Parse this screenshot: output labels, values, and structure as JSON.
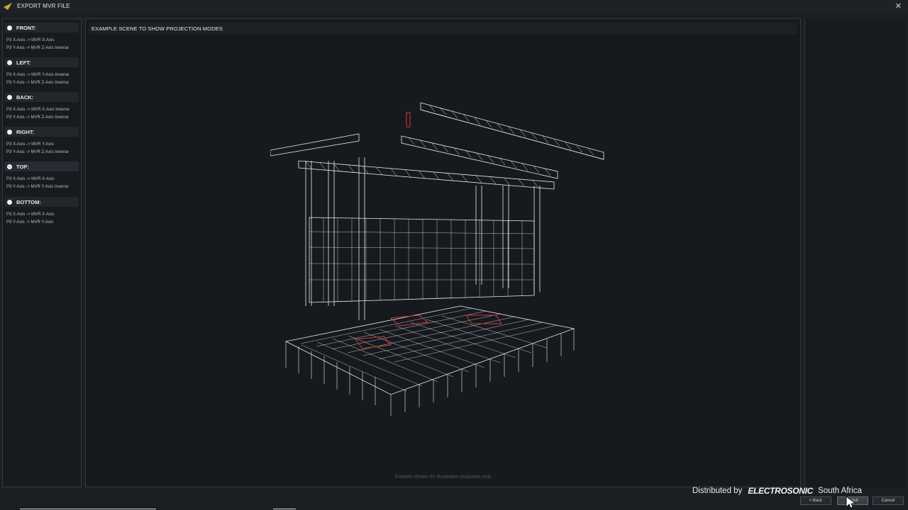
{
  "window": {
    "title": "EXPORT MVR FILE"
  },
  "modes": [
    {
      "label": "FRONT:",
      "lines": [
        "P3 X-Axis -> MVR X-Axis",
        "P3 Y-Axis -> MVR Z-Axis Inverse"
      ],
      "selected": false
    },
    {
      "label": "LEFT:",
      "lines": [
        "P3 X-Axis -> MVR Y-Axis Inverse",
        "P3 Y-Axis -> MVR Z-Axis Inverse"
      ],
      "selected": false
    },
    {
      "label": "BACK:",
      "lines": [
        "P3 X-Axis -> MVR X-Axis Inverse",
        "P3 Y-Axis -> MVR Z-Axis Inverse"
      ],
      "selected": false
    },
    {
      "label": "RIGHT:",
      "lines": [
        "P3 X-Axis -> MVR Y-Axis",
        "P3 Y-Axis -> MVR Z-Axis Inverse"
      ],
      "selected": false
    },
    {
      "label": "TOP:",
      "lines": [
        "P3 X-Axis -> MVR X-Axis",
        "P3 Y-Axis -> MVR Y-Axis Inverse"
      ],
      "selected": true
    },
    {
      "label": "BOTTOM:",
      "lines": [
        "P3 X-Axis -> MVR X-Axis",
        "P3 Y-Axis -> MVR Y-Axis"
      ],
      "selected": false
    }
  ],
  "scene": {
    "title": "EXAMPLE SCENE TO SHOW PROJECTION MODES",
    "disclaimer": "Fixtures shown for illustration purposes only"
  },
  "branding": {
    "prefix": "Distributed by",
    "name": "ELECTROSONIC",
    "suffix": "South Africa"
  },
  "buttons": {
    "back": "< Back",
    "finish": "Finish",
    "cancel": "Cancel"
  },
  "colors": {
    "accent": "#d9a63a",
    "highlight": "#d23a3a",
    "wire": "#e8ebee"
  }
}
